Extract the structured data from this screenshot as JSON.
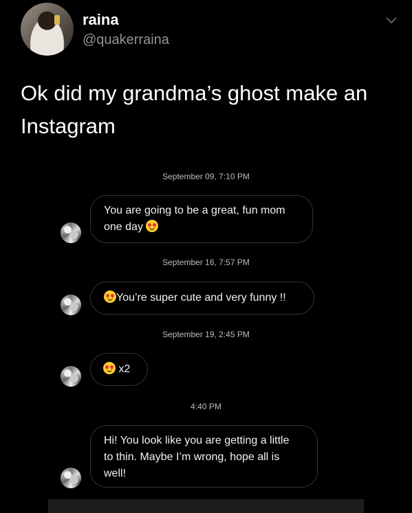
{
  "tweet": {
    "display_name": "raina",
    "handle": "@quakerraina",
    "text": "Ok did my grandma’s ghost make an Instagram"
  },
  "messages": [
    {
      "timestamp": "September 09, 7:10 PM",
      "text_a": "You are going to be a great, fun mom",
      "text_b": "one day"
    },
    {
      "timestamp": "September 16, 7:57 PM",
      "text": "You’re super cute and very funny !!"
    },
    {
      "timestamp": "September 19, 2:45 PM",
      "text": "x2"
    },
    {
      "timestamp": "4:40 PM",
      "line1": "Hi! You look like you are getting a little",
      "line2": "to thin. Maybe I’m wrong, hope all is",
      "line3": "well!"
    }
  ],
  "icons": {
    "emoji": "heart-eyes-emoji",
    "menu": "chevron-down-icon"
  },
  "colors": {
    "background": "#000000",
    "handle": "#8f949a",
    "bubble_border": "#303338"
  }
}
